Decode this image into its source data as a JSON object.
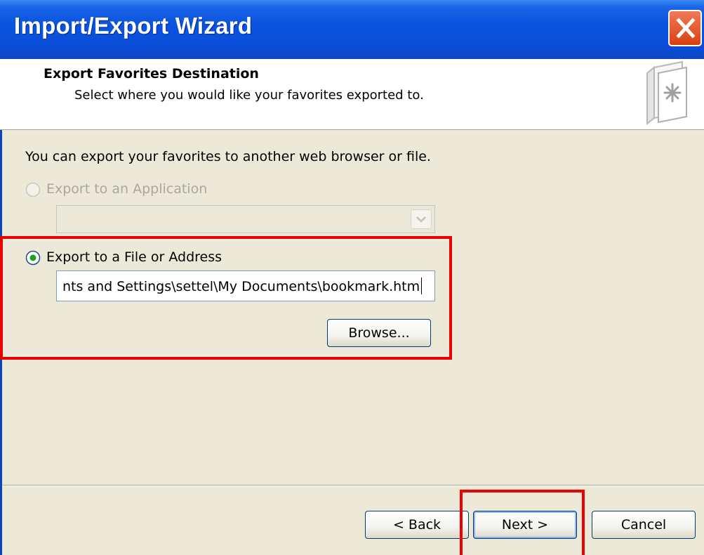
{
  "window": {
    "title": "Import/Export Wizard"
  },
  "header": {
    "title": "Export Favorites Destination",
    "subtitle": "Select where you would like your favorites exported to."
  },
  "body": {
    "intro": "You can export your favorites to another web browser or file.",
    "option_application": {
      "label": "Export to an Application",
      "enabled": false,
      "selected": false,
      "value": ""
    },
    "option_file": {
      "label": "Export to a File or Address",
      "enabled": true,
      "selected": true,
      "path": "nts and Settings\\settel\\My Documents\\bookmark.htm"
    },
    "browse_label": "Browse..."
  },
  "footer": {
    "back_label": "< Back",
    "next_label": "Next >",
    "cancel_label": "Cancel"
  },
  "colors": {
    "titlebar": "#0a54e0",
    "close": "#d8400f",
    "annotation": "#ee0000",
    "face": "#ece9d8"
  },
  "icons": {
    "close": "close-icon",
    "wizard": "favorites-export-icon",
    "combo": "chevron-down-icon"
  }
}
